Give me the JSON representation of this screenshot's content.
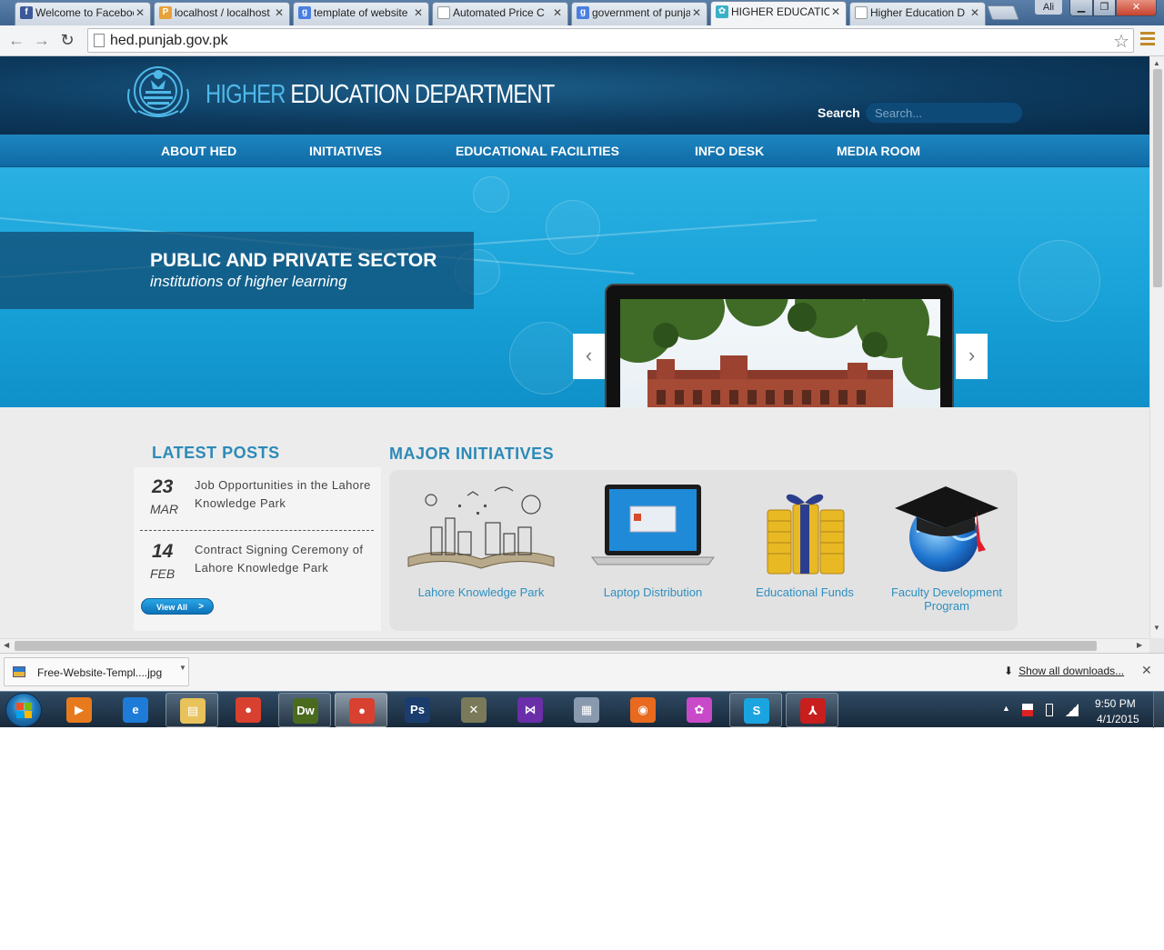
{
  "browser": {
    "tabs": [
      {
        "title": "Welcome to Facebook",
        "favicon": "facebook-icon",
        "color": "#3b5998",
        "glyph": "f"
      },
      {
        "title": "localhost / localhost",
        "favicon": "pma-icon",
        "color": "#e8a23a",
        "glyph": "P"
      },
      {
        "title": "template of website",
        "favicon": "google-icon",
        "color": "#4a7fe0",
        "glyph": "g"
      },
      {
        "title": "Automated Price C",
        "favicon": "page-icon",
        "color": "#dcdcdc",
        "glyph": ""
      },
      {
        "title": "government of punjab",
        "favicon": "google-icon",
        "color": "#4a7fe0",
        "glyph": "g"
      },
      {
        "title": "HIGHER EDUCATIO",
        "favicon": "hed-icon",
        "color": "#3ab0c8",
        "glyph": "✿"
      },
      {
        "title": "Higher Education D",
        "favicon": "page-icon",
        "color": "#dcdcdc",
        "glyph": ""
      }
    ],
    "profile_name": "Ali",
    "url": "hed.punjab.gov.pk"
  },
  "site": {
    "title_highlight": "HIGHER",
    "title_rest": " EDUCATION DEPARTMENT",
    "search_label": "Search",
    "search_placeholder": "Search...",
    "nav": [
      "ABOUT HED",
      "INITIATIVES",
      "EDUCATIONAL FACILITIES",
      "INFO DESK",
      "MEDIA ROOM"
    ],
    "hero": {
      "title": "PUBLIC AND PRIVATE SECTOR",
      "subtitle": "institutions of higher learning",
      "prev": "‹",
      "next": "›"
    },
    "latest_posts": {
      "heading": "LATEST POSTS",
      "posts": [
        {
          "day": "23",
          "month": "MAR",
          "text": "Job Opportunities in the Lahore Knowledge Park"
        },
        {
          "day": "14",
          "month": "FEB",
          "text": "Contract Signing Ceremony of Lahore Knowledge Park"
        }
      ],
      "view_all": "View All",
      "view_all_chevron": ">"
    },
    "major_initiatives": {
      "heading": "MAJOR INITIATIVES",
      "items": [
        {
          "label": "Lahore Knowledge Park",
          "icon": "book-city-icon"
        },
        {
          "label": "Laptop Distribution",
          "icon": "laptop-icon"
        },
        {
          "label": "Educational Funds",
          "icon": "coins-gift-icon"
        },
        {
          "label": "Faculty Development Program",
          "icon": "graduation-cap-globe-icon"
        }
      ]
    }
  },
  "downloads": {
    "file_name": "Free-Website-Templ....jpg",
    "show_all": "Show all downloads..."
  },
  "taskbar": {
    "apps": [
      {
        "name": "media-player",
        "glyph": "▶",
        "color": "#e87a1e",
        "open": false
      },
      {
        "name": "internet-explorer",
        "glyph": "e",
        "color": "#1e7bd8",
        "open": false
      },
      {
        "name": "file-explorer",
        "glyph": "▤",
        "color": "#e8c25a",
        "open": true
      },
      {
        "name": "chrome",
        "glyph": "●",
        "color": "#d8412f",
        "open": false
      },
      {
        "name": "dreamweaver",
        "glyph": "Dw",
        "color": "#4a6b1e",
        "open": true
      },
      {
        "name": "chrome-active",
        "glyph": "●",
        "color": "#d8412f",
        "open": true
      },
      {
        "name": "photoshop",
        "glyph": "Ps",
        "color": "#1a3d6e",
        "open": false
      },
      {
        "name": "tools",
        "glyph": "✕",
        "color": "#7a7a5a",
        "open": false
      },
      {
        "name": "visual-studio",
        "glyph": "⋈",
        "color": "#6a2ea8",
        "open": false
      },
      {
        "name": "sql-server",
        "glyph": "▦",
        "color": "#8a9aae",
        "open": false
      },
      {
        "name": "firefox",
        "glyph": "◉",
        "color": "#e86a1e",
        "open": false
      },
      {
        "name": "picasa",
        "glyph": "✿",
        "color": "#c84ac8",
        "open": false
      },
      {
        "name": "skype",
        "glyph": "S",
        "color": "#1aa5e0",
        "open": true
      },
      {
        "name": "acrobat",
        "glyph": "⅄",
        "color": "#c81e1e",
        "open": true
      }
    ],
    "time": "9:50 PM",
    "date": "4/1/2015"
  }
}
